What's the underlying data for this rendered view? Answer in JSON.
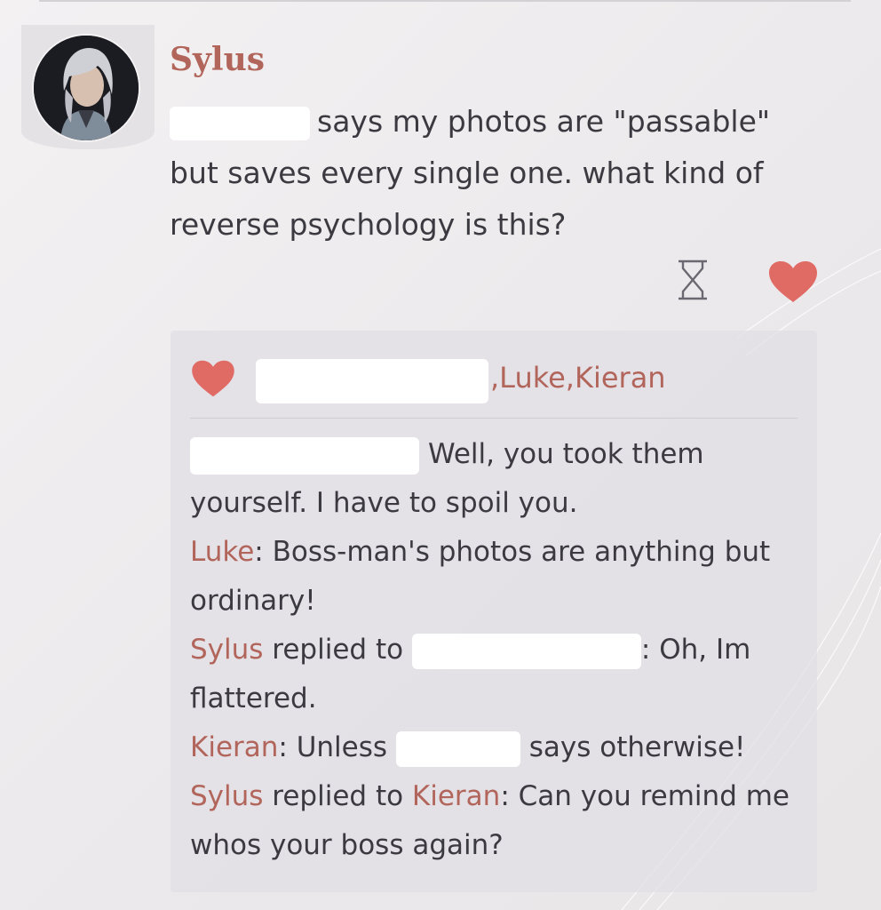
{
  "post": {
    "author": "Sylus",
    "text": "says my photos are \"passable\" but saves every single one. what kind of reverse psychology is this?"
  },
  "actions": {
    "hourglass_icon": "hourglass-icon",
    "like_icon": "heart-icon"
  },
  "likes": {
    "names_visible": ",Luke,Kieran"
  },
  "comments": [
    {
      "author": "",
      "target": "",
      "text": "Well, you took them yourself. I have to spoil you."
    },
    {
      "author": "Luke",
      "sep": ":",
      "text": "Boss-man's photos are anything but ordinary!"
    },
    {
      "author": "Sylus",
      "replied": "replied to",
      "target": "",
      "sep": ":",
      "text": "Oh, Im flattered."
    },
    {
      "author": "Kieran",
      "sep": ":",
      "pre": "Unless",
      "text": "says otherwise!"
    },
    {
      "author": "Sylus",
      "replied": "replied to",
      "target": "Kieran",
      "sep": ":",
      "text": "Can you remind me whos your boss again?"
    }
  ],
  "colors": {
    "accent": "#b2655a",
    "heart": "#e06a64",
    "text": "#3b3a40",
    "panel": "#e0dee4"
  }
}
